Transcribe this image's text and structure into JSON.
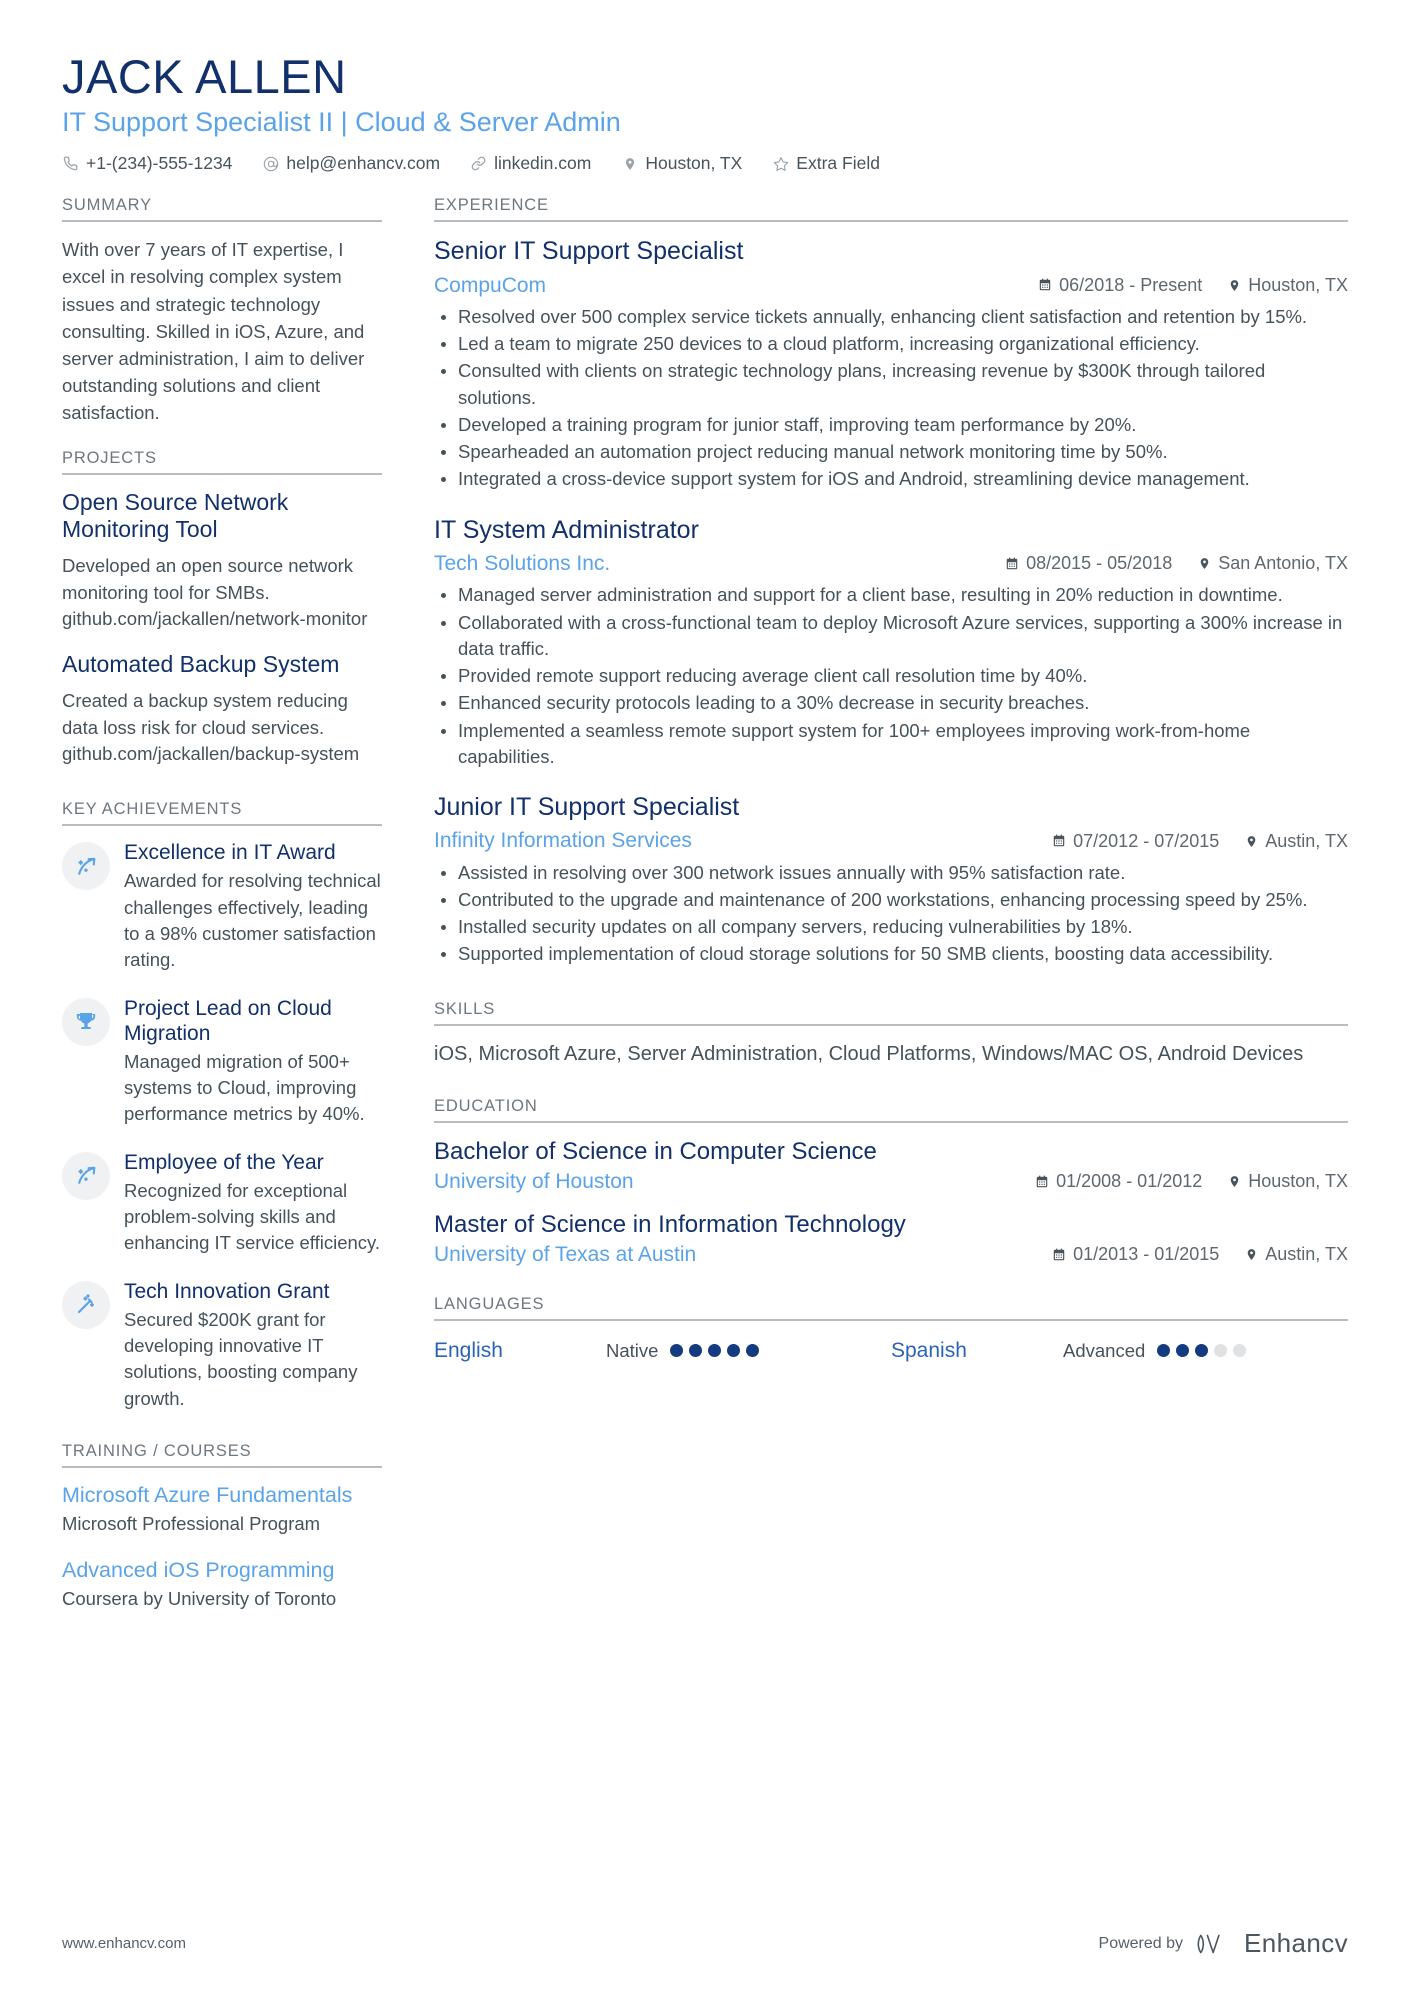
{
  "header": {
    "name": "JACK ALLEN",
    "headline": "IT Support Specialist II | Cloud & Server Admin",
    "contacts": [
      {
        "icon": "phone-icon",
        "text": "+1-(234)-555-1234"
      },
      {
        "icon": "email-icon",
        "text": "help@enhancv.com"
      },
      {
        "icon": "link-icon",
        "text": "linkedin.com"
      },
      {
        "icon": "location-pin-icon",
        "text": "Houston, TX"
      },
      {
        "icon": "star-icon",
        "text": "Extra Field"
      }
    ]
  },
  "left": {
    "summary": {
      "title": "SUMMARY",
      "text": "With over 7 years of IT expertise, I excel in resolving complex system issues and strategic technology consulting. Skilled in iOS, Azure, and server administration, I aim to deliver outstanding solutions and client satisfaction."
    },
    "projects": {
      "title": "PROJECTS",
      "items": [
        {
          "name": "Open Source Network Monitoring Tool",
          "description": "Developed an open source network monitoring tool for SMBs. github.com/jackallen/network-monitor"
        },
        {
          "name": "Automated Backup System",
          "description": "Created a backup system reducing data loss risk for cloud services. github.com/jackallen/backup-system"
        }
      ]
    },
    "achievements": {
      "title": "KEY ACHIEVEMENTS",
      "items": [
        {
          "icon": "growth-arrow-icon",
          "name": "Excellence in IT Award",
          "description": "Awarded for resolving technical challenges effectively, leading to a 98% customer satisfaction rating."
        },
        {
          "icon": "trophy-icon",
          "name": "Project Lead on Cloud Migration",
          "description": "Managed migration of 500+ systems to Cloud, improving performance metrics by 40%."
        },
        {
          "icon": "growth-arrow-icon",
          "name": "Employee of the Year",
          "description": "Recognized for exceptional problem-solving skills and enhancing IT service efficiency."
        },
        {
          "icon": "magic-wand-icon",
          "name": "Tech Innovation Grant",
          "description": "Secured $200K grant for developing innovative IT solutions, boosting company growth."
        }
      ]
    },
    "training": {
      "title": "TRAINING / COURSES",
      "items": [
        {
          "name": "Microsoft Azure Fundamentals",
          "provider": "Microsoft Professional Program"
        },
        {
          "name": "Advanced iOS Programming",
          "provider": "Coursera by University of Toronto"
        }
      ]
    }
  },
  "right": {
    "experience": {
      "title": "EXPERIENCE",
      "jobs": [
        {
          "role": "Senior IT Support Specialist",
          "company": "CompuCom",
          "dates": "06/2018 - Present",
          "location": "Houston, TX",
          "bullets": [
            "Resolved over 500 complex service tickets annually, enhancing client satisfaction and retention by 15%.",
            "Led a team to migrate 250 devices to a cloud platform, increasing organizational efficiency.",
            "Consulted with clients on strategic technology plans, increasing revenue by $300K through tailored solutions.",
            "Developed a training program for junior staff, improving team performance by 20%.",
            "Spearheaded an automation project reducing manual network monitoring time by 50%.",
            "Integrated a cross-device support system for iOS and Android, streamlining device management."
          ]
        },
        {
          "role": "IT System Administrator",
          "company": "Tech Solutions Inc.",
          "dates": "08/2015 - 05/2018",
          "location": "San Antonio, TX",
          "bullets": [
            "Managed server administration and support for a client base, resulting in 20% reduction in downtime.",
            "Collaborated with a cross-functional team to deploy Microsoft Azure services, supporting a 300% increase in data traffic.",
            "Provided remote support reducing average client call resolution time by 40%.",
            "Enhanced security protocols leading to a 30% decrease in security breaches.",
            "Implemented a seamless remote support system for 100+ employees improving work-from-home capabilities."
          ]
        },
        {
          "role": "Junior IT Support Specialist",
          "company": "Infinity Information Services",
          "dates": "07/2012 - 07/2015",
          "location": "Austin, TX",
          "bullets": [
            "Assisted in resolving over 300 network issues annually with 95% satisfaction rate.",
            "Contributed to the upgrade and maintenance of 200 workstations, enhancing processing speed by 25%.",
            "Installed security updates on all company servers, reducing vulnerabilities by 18%.",
            "Supported implementation of cloud storage solutions for 50 SMB clients, boosting data accessibility."
          ]
        }
      ]
    },
    "skills": {
      "title": "SKILLS",
      "text": "iOS, Microsoft Azure, Server Administration, Cloud Platforms, Windows/MAC OS, Android Devices"
    },
    "education": {
      "title": "EDUCATION",
      "items": [
        {
          "degree": "Bachelor of Science in Computer Science",
          "school": "University of Houston",
          "dates": "01/2008 - 01/2012",
          "location": "Houston, TX"
        },
        {
          "degree": "Master of Science in Information Technology",
          "school": "University of Texas at Austin",
          "dates": "01/2013 - 01/2015",
          "location": "Austin, TX"
        }
      ]
    },
    "languages": {
      "title": "LANGUAGES",
      "items": [
        {
          "name": "English",
          "level": "Native",
          "filled": 5,
          "total": 5
        },
        {
          "name": "Spanish",
          "level": "Advanced",
          "filled": 3,
          "total": 5
        }
      ]
    }
  },
  "footer": {
    "website": "www.enhancv.com",
    "powered_by": "Powered by",
    "brand": "Enhancv"
  },
  "colors": {
    "navy": "#12306b",
    "light_blue": "#5ba3e8",
    "body_text": "#46525a",
    "rule": "#b9bdc2",
    "dot_on": "#143a80",
    "dot_off": "#dfe1e3"
  }
}
